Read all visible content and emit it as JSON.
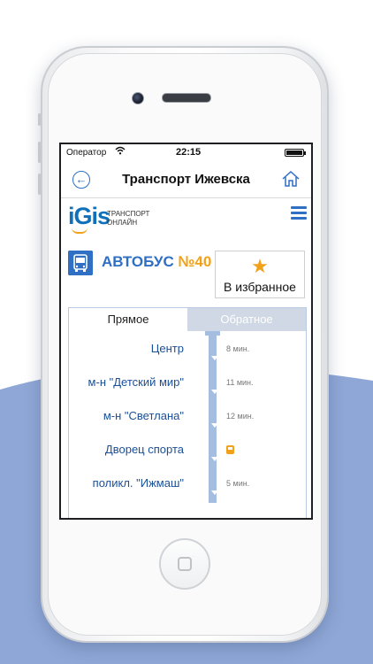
{
  "status_bar": {
    "carrier": "Оператор",
    "time": "22:15"
  },
  "nav": {
    "title": "Транспорт Ижевска",
    "back_icon": "back-arrow-icon",
    "home_icon": "home-icon"
  },
  "brand": {
    "logo_text": "iGis",
    "tagline_line1": "ТРАНСПОРТ",
    "tagline_line2": "ОНЛАЙН",
    "menu_icon": "hamburger-menu-icon"
  },
  "route": {
    "type_label": "АВТОБУС",
    "number": "№40",
    "favorite_label": "В избранное",
    "favorite_icon": "star-icon"
  },
  "tabs": [
    {
      "label": "Прямое",
      "active": true
    },
    {
      "label": "Обратное",
      "active": false
    }
  ],
  "stops": [
    {
      "name": "Центр",
      "eta": "8 мин."
    },
    {
      "name": "м-н \"Детский мир\"",
      "eta": "11 мин."
    },
    {
      "name": "м-н \"Светлана\"",
      "eta": "12 мин."
    },
    {
      "name": "Дворец спорта",
      "eta": "",
      "bus_here": true
    },
    {
      "name": "поликл. \"Ижмаш\"",
      "eta": "5 мин."
    }
  ],
  "colors": {
    "accent": "#2f6fc4",
    "brand_orange": "#f2a21a",
    "route_line": "#a5bddf",
    "background_blue": "#8fa7d6"
  }
}
